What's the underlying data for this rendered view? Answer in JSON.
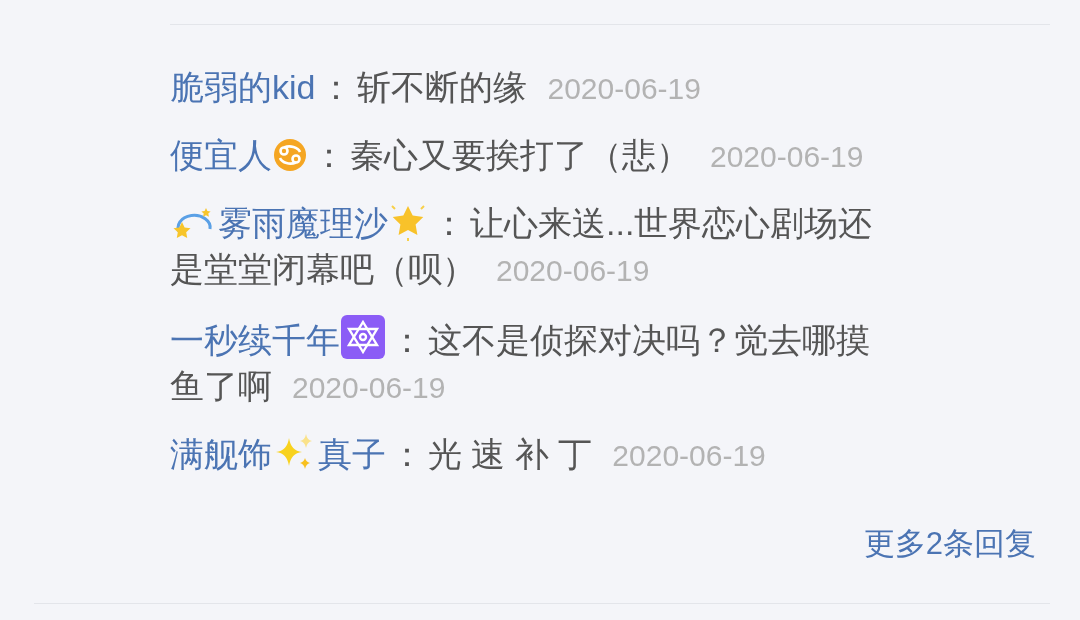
{
  "comments": [
    {
      "name_parts": [
        {
          "kind": "text",
          "text": "脆弱的kid"
        }
      ],
      "separator": "：",
      "content_lines": [
        "斩不断的缘"
      ],
      "date": "2020-06-19"
    },
    {
      "name_parts": [
        {
          "kind": "text",
          "text": "便宜人"
        },
        {
          "kind": "zodiac"
        }
      ],
      "separator": "：",
      "content_lines": [
        "秦心又要挨打了（悲）"
      ],
      "date": "2020-06-19"
    },
    {
      "name_parts": [
        {
          "kind": "swirl"
        },
        {
          "kind": "text",
          "text": "雾雨魔理沙"
        },
        {
          "kind": "star"
        }
      ],
      "separator": "：",
      "content_lines": [
        "让心来送...世界恋心剧场还",
        "是堂堂闭幕吧（呗）"
      ],
      "date": "2020-06-19"
    },
    {
      "name_parts": [
        {
          "kind": "text",
          "text": "一秒续千年"
        },
        {
          "kind": "hexagram"
        }
      ],
      "separator": "：",
      "content_lines": [
        "这不是侦探对决吗？觉去哪摸",
        "鱼了啊"
      ],
      "date": "2020-06-19"
    },
    {
      "name_parts": [
        {
          "kind": "text",
          "text": "满舰饰"
        },
        {
          "kind": "sparkles"
        },
        {
          "kind": "text",
          "text": "真子"
        }
      ],
      "separator": "：",
      "content_lines": [
        "光 速 补 丁"
      ],
      "date": "2020-06-19"
    }
  ],
  "more_replies": "更多2条回复"
}
